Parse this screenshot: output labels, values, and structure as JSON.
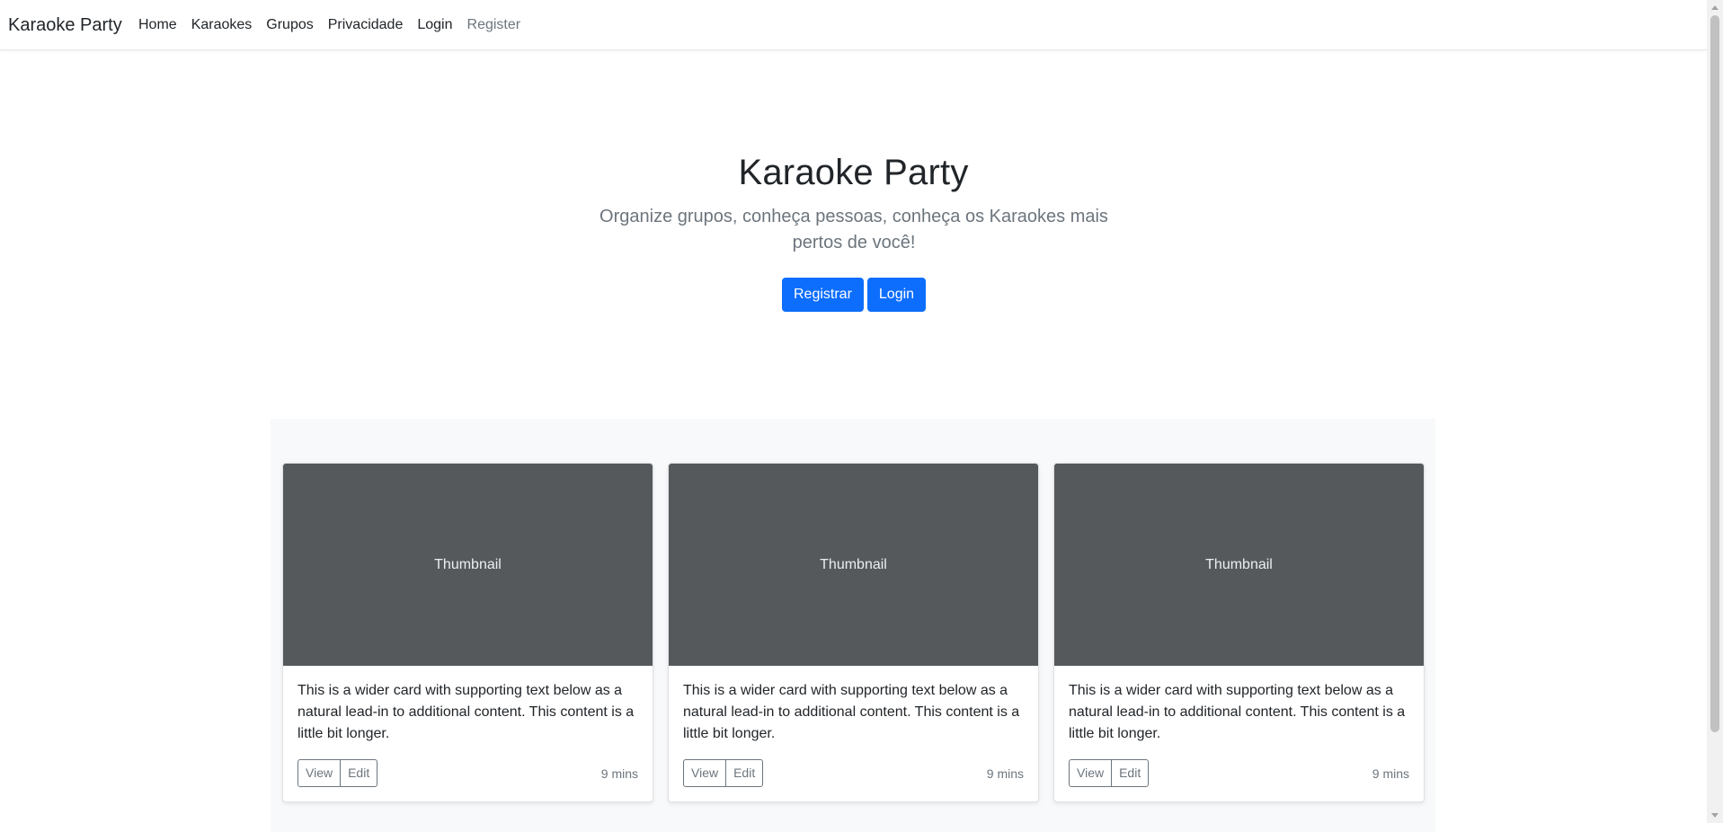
{
  "navbar": {
    "brand": "Karaoke Party",
    "links": [
      {
        "label": "Home"
      },
      {
        "label": "Karaokes"
      },
      {
        "label": "Grupos"
      },
      {
        "label": "Privacidade"
      },
      {
        "label": "Login"
      },
      {
        "label": "Register"
      }
    ]
  },
  "hero": {
    "title": "Karaoke Party",
    "lead": "Organize grupos, conheça pessoas, conheça os Karaokes mais pertos de você!",
    "register_label": "Registrar",
    "login_label": "Login"
  },
  "cards": [
    {
      "thumbnail": "Thumbnail",
      "text": "This is a wider card with supporting text below as a natural lead-in to additional content. This content is a little bit longer.",
      "view_label": "View",
      "edit_label": "Edit",
      "time": "9 mins"
    },
    {
      "thumbnail": "Thumbnail",
      "text": "This is a wider card with supporting text below as a natural lead-in to additional content. This content is a little bit longer.",
      "view_label": "View",
      "edit_label": "Edit",
      "time": "9 mins"
    },
    {
      "thumbnail": "Thumbnail",
      "text": "This is a wider card with supporting text below as a natural lead-in to additional content. This content is a little bit longer.",
      "view_label": "View",
      "edit_label": "Edit",
      "time": "9 mins"
    }
  ],
  "colors": {
    "primary": "#0d6efd",
    "thumbnail_bg": "#55595c",
    "muted": "#6c757d",
    "album_bg": "#f8f9fa"
  }
}
